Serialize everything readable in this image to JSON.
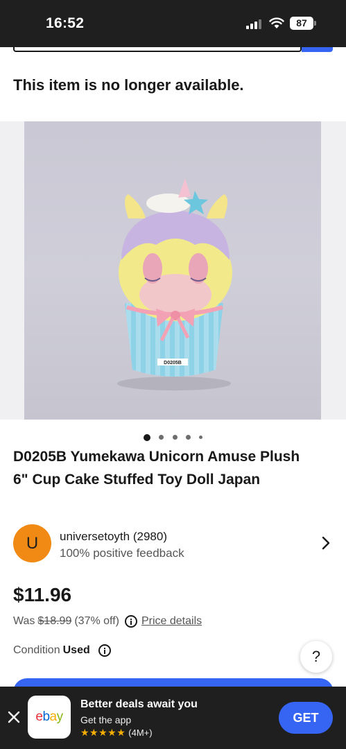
{
  "status_bar": {
    "time": "16:52",
    "battery": "87"
  },
  "page": {
    "unavailable_notice": "This item is no longer available."
  },
  "gallery": {
    "label_on_photo": "D0205B",
    "dot_count": 5,
    "active_dot": 1
  },
  "item": {
    "title": "D0205B Yumekawa Unicorn Amuse Plush 6\" Cup Cake Stuffed Toy Doll Japan"
  },
  "seller": {
    "avatar_letter": "U",
    "name": "universetoyth (2980)",
    "feedback": "100% positive feedback"
  },
  "pricing": {
    "price": "$11.96",
    "was_label": "Was",
    "was_price": "$18.99",
    "discount": "(37% off)",
    "price_details_link": "Price details"
  },
  "condition": {
    "label": "Condition",
    "value": "Used"
  },
  "help_button": {
    "label": "?"
  },
  "app_banner": {
    "logo_text": "ebay",
    "title": "Better deals await you",
    "subtitle": "Get the app",
    "stars": "★★★★★",
    "rating_count": "(4M+)",
    "get_label": "GET"
  },
  "colors": {
    "accent": "#3665f3",
    "avatar": "#f18a14",
    "dark_bar": "#1f1f1f"
  }
}
